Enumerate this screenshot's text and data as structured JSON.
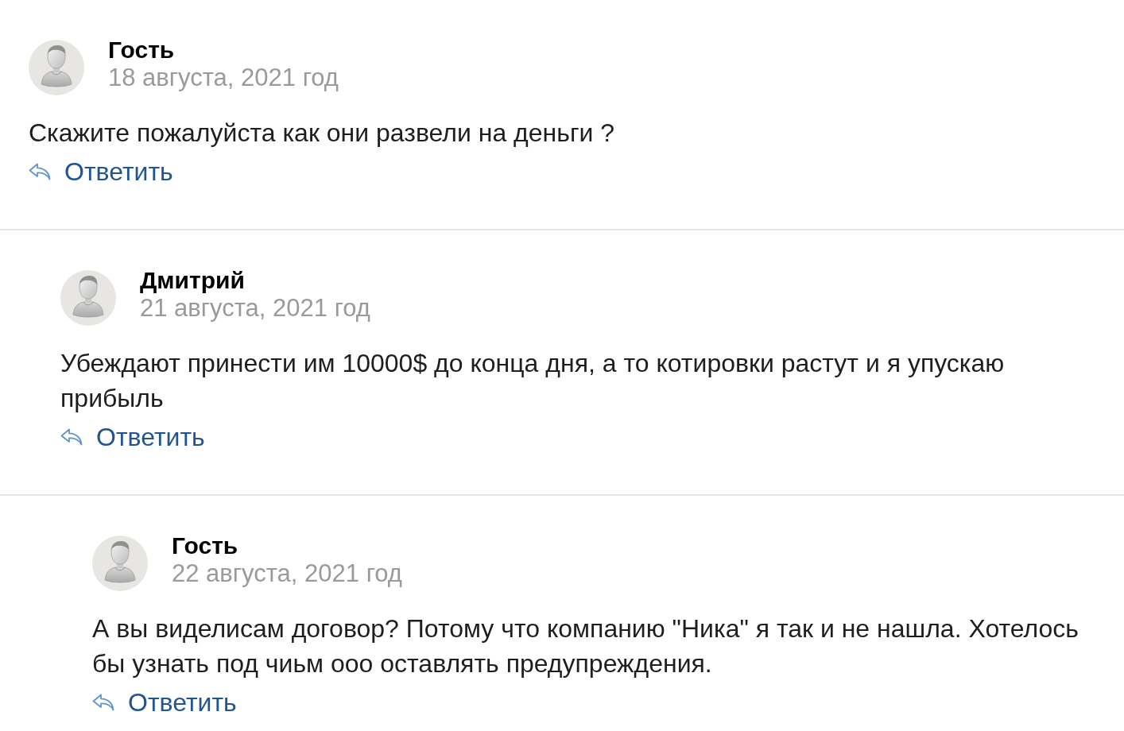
{
  "comments": [
    {
      "author": "Гость",
      "date": "18 августа, 2021 год",
      "text": "Скажите пожалуйста как они развели на деньги ?",
      "reply_label": "Ответить",
      "children": [
        {
          "author": "Дмитрий",
          "date": "21 августа, 2021 год",
          "text": "Убеждают принести им 10000$ до конца дня, а то котировки растут и я упускаю прибыль",
          "reply_label": "Ответить",
          "children": [
            {
              "author": "Гость",
              "date": "22 августа, 2021 год",
              "text": "А вы виделисам договор? Потому что компанию \"Ника\" я так и не нашла. Хотелось бы узнать под чиьм ооо оставлять предупреждения.",
              "reply_label": "Ответить"
            }
          ]
        }
      ]
    }
  ]
}
